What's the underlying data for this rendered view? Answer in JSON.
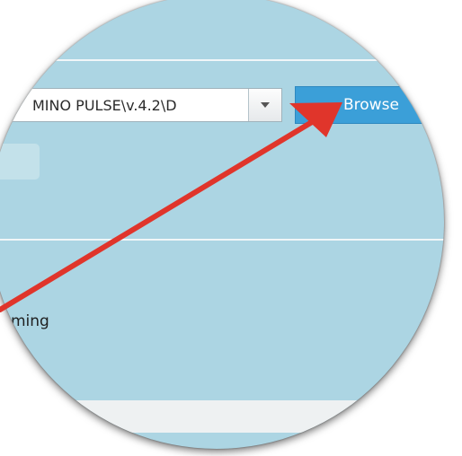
{
  "file_path": {
    "value": "MINO PULSE\\v.4.2\\D"
  },
  "browse_button": {
    "label": "Browse"
  },
  "options": {
    "partial_label": "ming"
  },
  "annotation": {
    "arrow_color": "#e0352b"
  },
  "colors": {
    "panel_background": "#acd5e3",
    "button_blue": "#3b9fd8"
  }
}
